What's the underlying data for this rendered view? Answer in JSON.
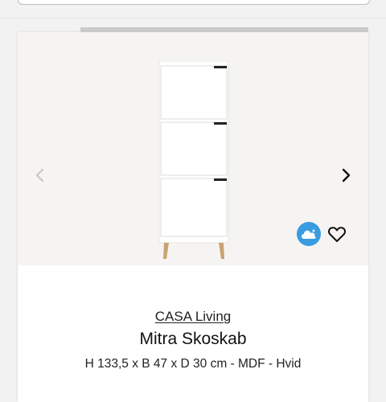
{
  "product": {
    "brand": "CASA Living",
    "title": "Mitra Skoskab",
    "specs": "H 133,5 x B 47 x D 30 cm - MDF - Hvid"
  },
  "icons": {
    "prev": "chevron-left-icon",
    "next": "chevron-right-icon",
    "badge": "cloud-icon",
    "favorite": "heart-outline-icon"
  },
  "colors": {
    "badge": "#3a9be0",
    "image_background": "#f6f4f2"
  }
}
